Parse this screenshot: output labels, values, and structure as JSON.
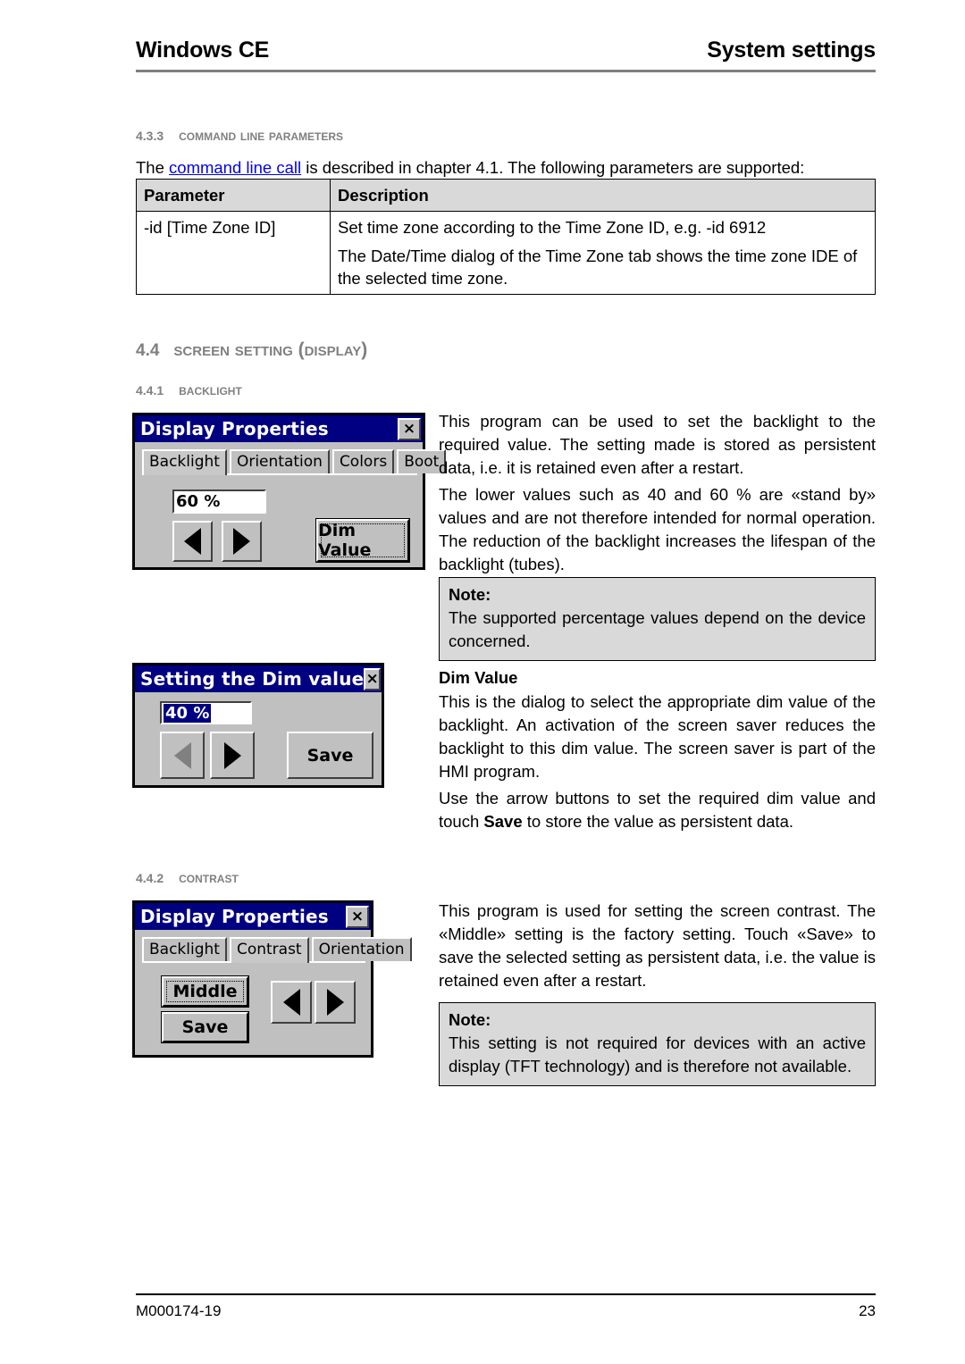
{
  "header": {
    "left": "Windows CE",
    "right": "System settings"
  },
  "footer": {
    "doc_id": "M000174-19",
    "page_number": "23"
  },
  "sections": {
    "cmdline": {
      "number": "4.3.3",
      "title": "Command line parameters",
      "intro_before_link": "The ",
      "intro_link": "command line call",
      "intro_after_link": " is described in chapter 4.1. The following parameters are supported:"
    },
    "screen_setting": {
      "number": "4.4",
      "title": "Screen setting (Display)"
    },
    "backlight": {
      "number": "4.4.1",
      "title": "Backlight",
      "paragraph_1": "This program can be used to set the backlight to the required value. The setting made is stored as persistent data, i.e. it is retained even after a restart.",
      "paragraph_2": "The lower values such as 40 and 60 % are «stand by» values and are not therefore intended for normal operation. The reduction of the backlight increases the lifespan of the backlight (tubes).",
      "note_title": "Note:",
      "note_body": "The supported percentage values depend on the device concerned."
    },
    "dim_value": {
      "heading": "Dim Value",
      "paragraph_1": "This is the dialog to select the appropriate dim value of the backlight. An activation of the screen saver reduces the backlight to this dim value. The screen saver is part of the HMI program.",
      "paragraph_2_part1": "Use the arrow buttons to set the required dim value and touch ",
      "paragraph_2_bold": "Save",
      "paragraph_2_part2": " to store the value as persistent data."
    },
    "contrast": {
      "number": "4.4.2",
      "title": "Contrast",
      "paragraph_1": "This program is used for setting the screen contrast. The «Middle» setting is the factory setting. Touch «Save» to save the selected setting as persistent data, i.e. the value is retained even after a restart.",
      "note_title": "Note:",
      "note_body": "This setting is not required for devices with an active display (TFT technology) and is therefore not available."
    }
  },
  "param_table": {
    "headers": [
      "Parameter",
      "Description"
    ],
    "rows": [
      {
        "parameter": "-id [Time Zone ID]",
        "description_lines": [
          "Set time zone according to the Time Zone ID, e.g. -id 6912",
          "The Date/Time dialog of the Time Zone tab shows the time zone IDE of the selected time zone."
        ]
      }
    ]
  },
  "dialogs": {
    "backlight": {
      "title": "Display Properties",
      "close_label": "×",
      "tabs": [
        "Backlight",
        "Orientation",
        "Colors",
        "Boot"
      ],
      "active_tab": "Backlight",
      "value": "60 %",
      "left_arrow": "arrow-left-icon",
      "right_arrow": "arrow-right-icon",
      "button_label": "Dim Value"
    },
    "dim_value": {
      "title": "Setting the Dim value",
      "close_label": "×",
      "value": "40 %",
      "left_arrow": "arrow-left-icon",
      "right_arrow": "arrow-right-icon",
      "button_label": "Save"
    },
    "contrast": {
      "title": "Display Properties",
      "close_label": "×",
      "tabs": [
        "Backlight",
        "Contrast",
        "Orientation"
      ],
      "active_tab": "Contrast",
      "setting_label": "Middle",
      "save_label": "Save",
      "left_arrow": "arrow-left-icon",
      "right_arrow": "arrow-right-icon"
    }
  },
  "colors": {
    "titlebar": "#000080",
    "dialog_face": "#c0c0c0",
    "note_bg": "#d9d9d9",
    "heading_grey": "#808080",
    "link_blue": "#0000ee"
  }
}
